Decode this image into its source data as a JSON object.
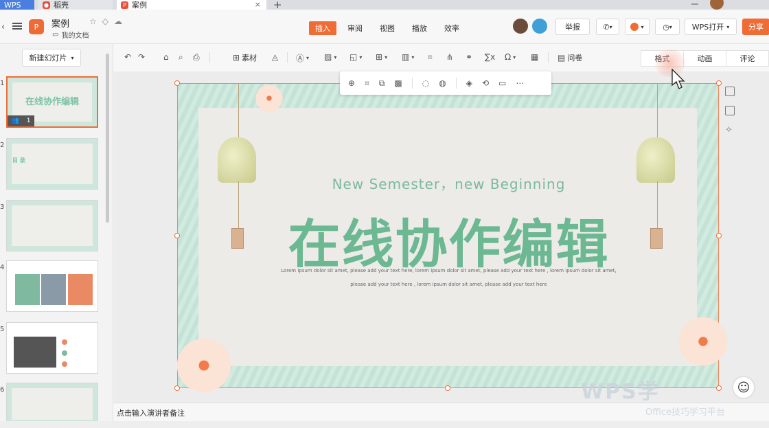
{
  "titlebar": {
    "tabs": [
      {
        "label": "WPS"
      },
      {
        "label": "稻壳"
      },
      {
        "label": "案例"
      }
    ],
    "close": "×",
    "add": "+"
  },
  "header": {
    "doc_name": "案例",
    "doc_location": "我的文档",
    "menus": [
      "插入",
      "审阅",
      "视图",
      "播放",
      "效率"
    ],
    "active_menu": "插入",
    "report_label": "举报",
    "wps_open_label": "WPS打开",
    "share_label": "分享"
  },
  "toolbar": {
    "material_label": "素材",
    "qa_label": "问卷",
    "sigma": "∑x",
    "omega": "Ω",
    "side_tabs": [
      "格式",
      "动画",
      "评论"
    ]
  },
  "left_panel": {
    "new_slide_label": "新建幻灯片",
    "badge_count": "1",
    "thumbnails": [
      {
        "num": "1",
        "title": "在线协作编辑"
      },
      {
        "num": "2",
        "title": "目 录"
      },
      {
        "num": "3",
        "title": ""
      },
      {
        "num": "4",
        "title": ""
      },
      {
        "num": "5",
        "title": ""
      },
      {
        "num": "6",
        "title": ""
      }
    ]
  },
  "slide": {
    "subtitle": "New Semester，new Beginning",
    "title": "在线协作编辑",
    "line1": "Lorem ipsum dolor sit amet, please add your text here, lorem ipsum dolor sit amet, please add your text here , lorem ipsum dolor sit amet,",
    "line2": "please add your text here , lorem ipsum dolor sit amet, please add your text here"
  },
  "notes": {
    "placeholder": "点击输入演讲者备注"
  },
  "watermark": {
    "brand": "WPS学",
    "sub": "Office技巧学习平台"
  },
  "colors": {
    "accent": "#f06c35",
    "title_green": "#6bb892",
    "frame_green": "#cfe8de"
  }
}
